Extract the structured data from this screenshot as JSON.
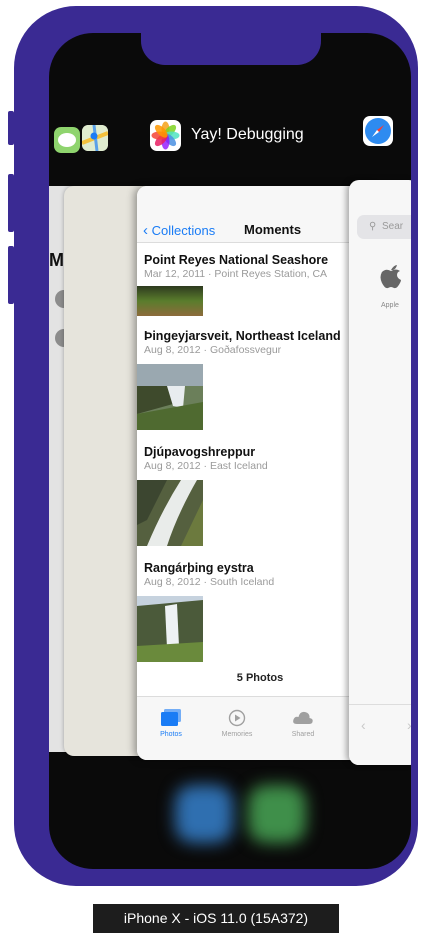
{
  "switcher": {
    "active_app_name": "Yay! Debugging",
    "device_caption": "iPhone X - iOS 11.0 (15A372)"
  },
  "left_card": {
    "partial_title": "M"
  },
  "photos": {
    "nav": {
      "back_label": "Collections",
      "title": "Moments"
    },
    "moments": [
      {
        "title": "Point Reyes National Seashore",
        "subtitle": "Mar 12, 2011 · Point Reyes Station, CA"
      },
      {
        "title": "Þingeyjarsveit, Northeast Iceland",
        "subtitle": "Aug 8, 2012 · Goðafossvegur"
      },
      {
        "title": "Djúpavogshreppur",
        "subtitle": "Aug 8, 2012 · East Iceland"
      },
      {
        "title": "Rangárþing eystra",
        "subtitle": "Aug 8, 2012 · South Iceland"
      }
    ],
    "photo_count": "5 Photos",
    "tabs": [
      {
        "label": "Photos",
        "icon": "photos-tab-icon",
        "active": true
      },
      {
        "label": "Memories",
        "icon": "memories-tab-icon",
        "active": false
      },
      {
        "label": "Shared",
        "icon": "shared-cloud-icon",
        "active": false
      }
    ]
  },
  "safari": {
    "search_placeholder": "Sear",
    "favorite_label": "Apple"
  },
  "colors": {
    "frame": "#3a2a93",
    "accent_blue": "#1a7cf5",
    "screen": "#0a0a0a"
  }
}
